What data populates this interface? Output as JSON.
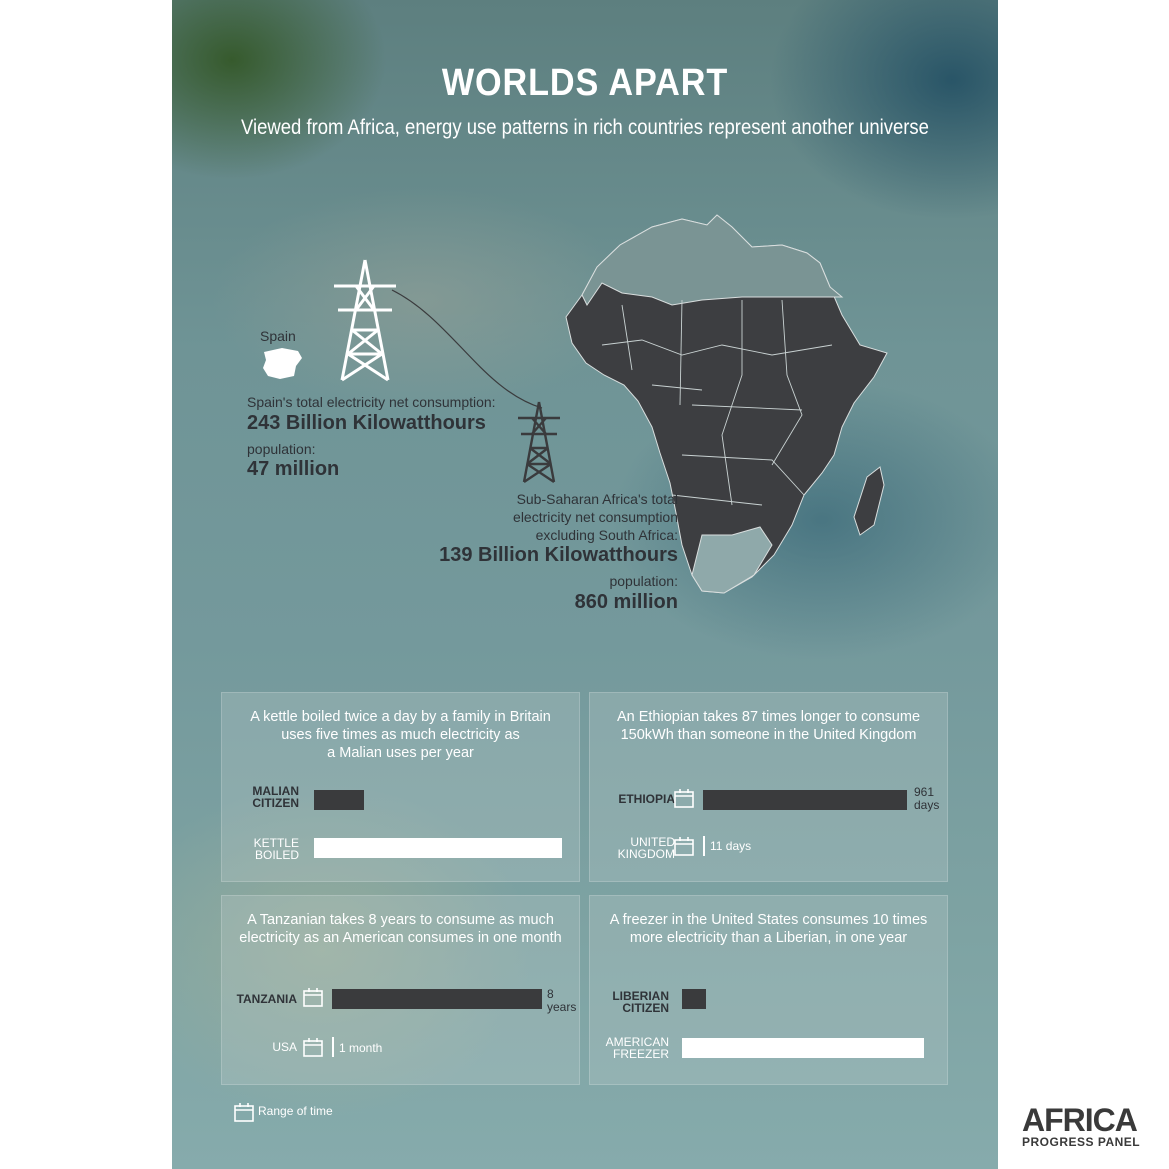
{
  "title": "WORLDS APART",
  "subtitle": "Viewed from Africa, energy use patterns in rich countries represent another universe",
  "spain": {
    "label": "Spain",
    "consumption_label": "Spain's total electricity net consumption:",
    "consumption_value": "243 Billion Kilowatthours",
    "population_label": "population:",
    "population_value": "47 million"
  },
  "ssa": {
    "consumption_line1": "Sub-Saharan Africa's total",
    "consumption_line2": "electricity net consumption",
    "consumption_line3": "excluding South Africa:",
    "consumption_value": "139 Billion Kilowatthours",
    "population_label": "population:",
    "population_value": "860 million"
  },
  "panels": {
    "kettle": {
      "title_l1": "A kettle boiled twice a day by a family in Britain",
      "title_l2": "uses five times as much electricity as",
      "title_l3": "a Malian uses per year",
      "row1_l1": "MALIAN",
      "row1_l2": "CITIZEN",
      "row2_l1": "KETTLE",
      "row2_l2": "BOILED",
      "ratio": 5
    },
    "ethiopia": {
      "title_l1": "An Ethiopian takes 87 times longer to consume",
      "title_l2": "150kWh than someone in the United Kingdom",
      "row1": "ETHIOPIA",
      "row1_value_num": "961",
      "row1_value_unit": "days",
      "row2_l1": "UNITED",
      "row2_l2": "KINGDOM",
      "row2_value": "11 days",
      "ratio": 87
    },
    "tanzania": {
      "title_l1": "A Tanzanian takes 8 years to consume as much",
      "title_l2": "electricity as an American consumes in one month",
      "row1": "TANZANIA",
      "row1_value_num": "8",
      "row1_value_unit": "years",
      "row2": "USA",
      "row2_value": "1 month",
      "ratio": 96
    },
    "freezer": {
      "title_l1": "A freezer in the United States consumes 10 times",
      "title_l2": "more electricity than a Liberian, in one year",
      "row1_l1": "LIBERIAN",
      "row1_l2": "CITIZEN",
      "row2_l1": "AMERICAN",
      "row2_l2": "FREEZER",
      "ratio": 10
    }
  },
  "legend": {
    "icon": "calendar-icon",
    "label": "Range of time"
  },
  "logo": {
    "brand": "AFRICA",
    "sub": "PROGRESS PANEL"
  }
}
